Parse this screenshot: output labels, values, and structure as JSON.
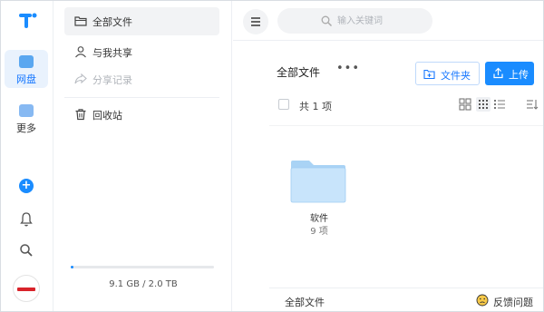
{
  "rail": {
    "items": [
      {
        "label": "网盘",
        "icon": "cloud-drive-icon"
      },
      {
        "label": "更多",
        "icon": "more-apps-icon"
      }
    ],
    "plus_label": "+",
    "accent": "#1a8cff"
  },
  "nav": {
    "items": [
      {
        "label": "全部文件",
        "icon": "folder-icon"
      },
      {
        "label": "与我共享",
        "icon": "user-icon"
      },
      {
        "label": "分享记录",
        "icon": "share-icon"
      },
      {
        "label": "回收站",
        "icon": "trash-icon"
      }
    ],
    "storage_text": "9.1 GB / 2.0 TB",
    "storage_used_fraction": 0.0045
  },
  "search": {
    "placeholder": "输入关键词"
  },
  "main": {
    "title": "全部文件",
    "more_label": "•••",
    "new_folder_label": "文件夹",
    "upload_label": "上传",
    "count_label": "共 1 项",
    "folders": [
      {
        "name": "软件",
        "count": "9 项"
      }
    ],
    "footer_label": "全部文件",
    "feedback_label": "反馈问题"
  }
}
